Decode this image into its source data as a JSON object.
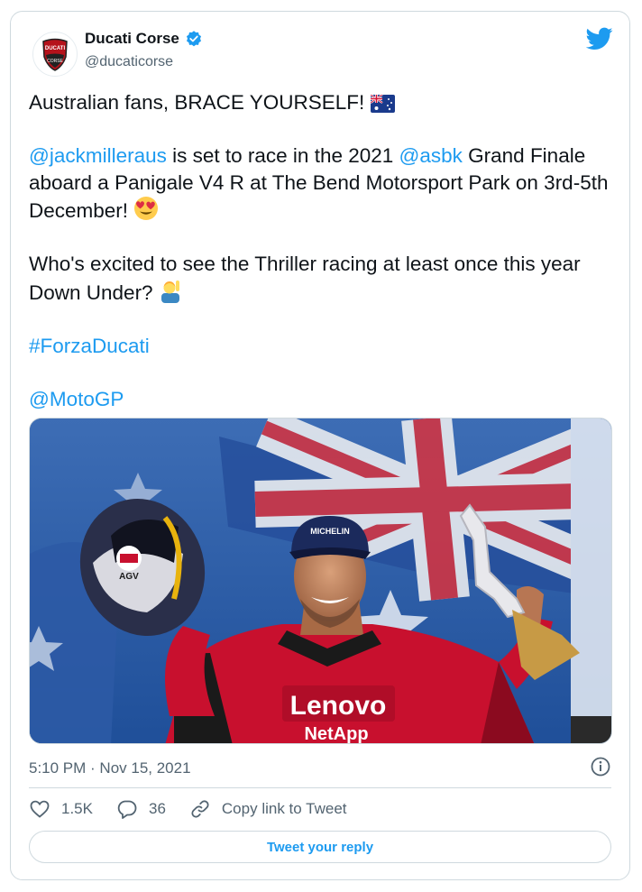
{
  "author": {
    "display_name": "Ducati Corse",
    "handle": "@ducaticorse",
    "logo_text_top": "DUCATI",
    "logo_text_bottom": "CORSE"
  },
  "tweet": {
    "line1": "Australian fans, BRACE YOURSELF!",
    "mention_jack": "@jackmilleraus",
    "p2_a": " is set to race in the 2021 ",
    "mention_asbk": "@asbk",
    "p2_b": " Grand Finale aboard a Panigale V4 R at The Bend Motorsport Park on 3rd-5th December! ",
    "p3": "Who's excited to see the Thriller racing at least once this year Down Under? ",
    "hashtag": "#ForzaDucati",
    "mention_motogp": "@MotoGP"
  },
  "media": {
    "cap_text": "MICHELIN",
    "shirt_brand": "Lenovo",
    "shirt_sponsor": "NetApp",
    "helmet_text": "AGV"
  },
  "timestamp": "5:10 PM · Nov 15, 2021",
  "actions": {
    "likes": "1.5K",
    "replies": "36",
    "copy_link": "Copy link to Tweet"
  },
  "reply_button": "Tweet your reply",
  "colors": {
    "accent": "#1d9bf0",
    "ducati_red": "#cc0000",
    "text_secondary": "#536471"
  }
}
